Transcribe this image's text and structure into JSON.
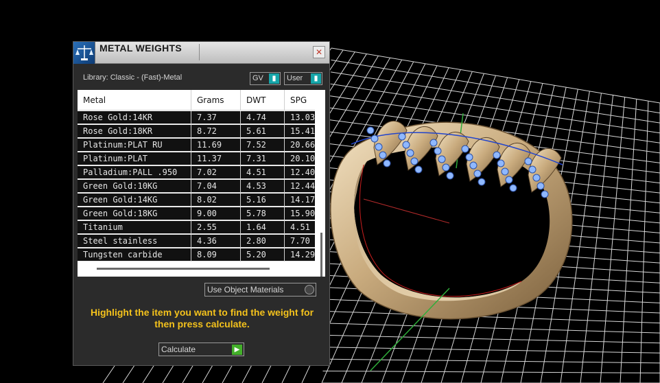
{
  "panel": {
    "title": "METAL WEIGHTS",
    "close_glyph": "✕",
    "library_label": "Library: Classic - (Fast)-Metal",
    "toggles": {
      "gv": "GV",
      "user": "User"
    },
    "use_object_label": "Use Object Materials",
    "hint": "Highlight the item you want to find the weight for then press calculate.",
    "calculate_label": "Calculate"
  },
  "table": {
    "headers": [
      "Metal",
      "Grams",
      "DWT",
      "SPG"
    ],
    "rows": [
      [
        "Rose Gold:14KR",
        "7.37",
        "4.74",
        "13.03"
      ],
      [
        "Rose Gold:18KR",
        "8.72",
        "5.61",
        "15.41"
      ],
      [
        "Platinum:PLAT RU",
        "11.69",
        "7.52",
        "20.66"
      ],
      [
        "Platinum:PLAT",
        "11.37",
        "7.31",
        "20.10"
      ],
      [
        "Palladium:PALL .950",
        "7.02",
        "4.51",
        "12.40"
      ],
      [
        "Green Gold:10KG",
        "7.04",
        "4.53",
        "12.44"
      ],
      [
        "Green Gold:14KG",
        "8.02",
        "5.16",
        "14.17"
      ],
      [
        "Green Gold:18KG",
        "9.00",
        "5.78",
        "15.90"
      ],
      [
        "Titanium",
        "2.55",
        "1.64",
        "4.51"
      ],
      [
        "Steel stainless",
        "4.36",
        "2.80",
        "7.70"
      ],
      [
        "Tungsten carbide",
        "8.09",
        "5.20",
        "14.29"
      ]
    ]
  },
  "icons": {
    "app_icon": "scale-icon",
    "toggle_knob": "toggle-knob-icon",
    "calculate_arrow": "play-arrow-icon"
  },
  "colors": {
    "hint": "#f4c21c",
    "toggle_accent": "#16a5a9",
    "calculate_accent": "#43b02a"
  }
}
